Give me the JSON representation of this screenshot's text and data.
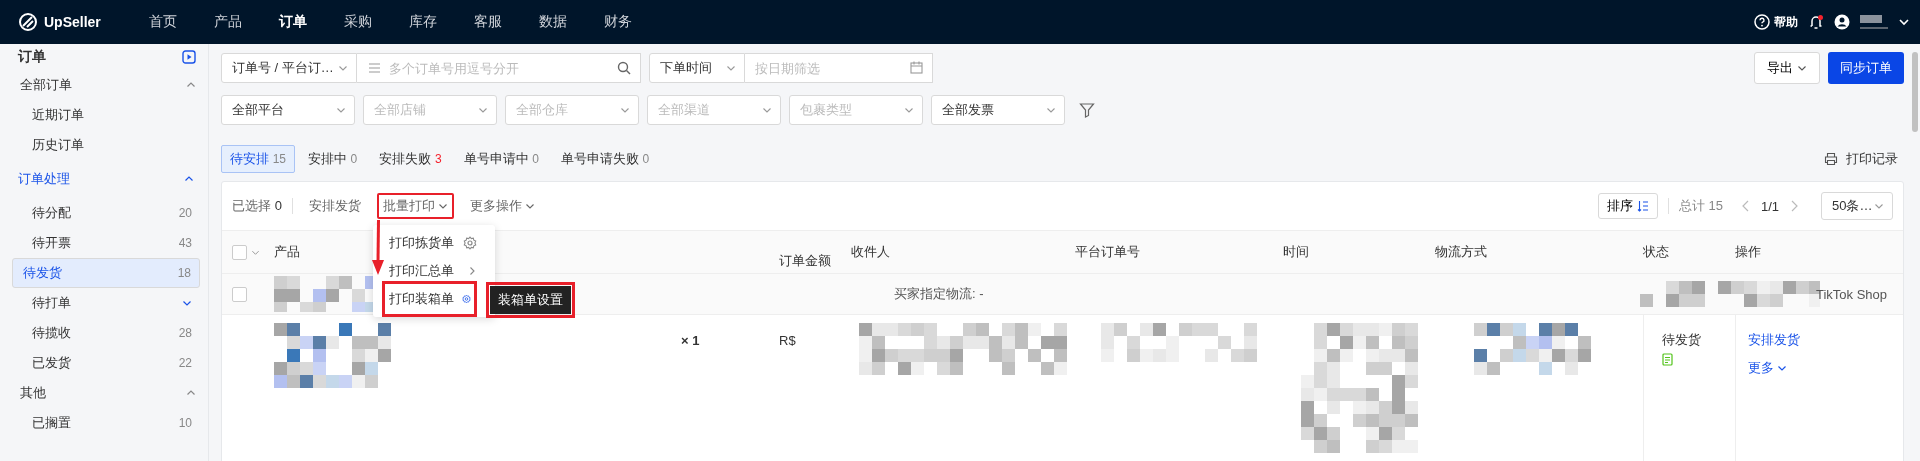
{
  "brand": "UpSeller",
  "nav": [
    {
      "label": "首页",
      "selected": false
    },
    {
      "label": "产品",
      "selected": false
    },
    {
      "label": "订单",
      "selected": true
    },
    {
      "label": "采购",
      "selected": false
    },
    {
      "label": "库存",
      "selected": false
    },
    {
      "label": "客服",
      "selected": false
    },
    {
      "label": "数据",
      "selected": false
    },
    {
      "label": "财务",
      "selected": false
    }
  ],
  "header": {
    "help": "帮助",
    "unread": true
  },
  "sidebar": {
    "title": "订单",
    "groups": [
      {
        "label": "全部订单",
        "active": false,
        "expanded": true,
        "items": [
          {
            "label": "近期订单",
            "kind": "link",
            "selected": false
          },
          {
            "label": "历史订单",
            "kind": "link",
            "selected": false
          }
        ]
      },
      {
        "label": "订单处理",
        "active": true,
        "expanded": true,
        "items": [
          {
            "label": "待分配",
            "kind": "count",
            "count": "20",
            "selected": false
          },
          {
            "label": "待开票",
            "kind": "count",
            "count": "43",
            "selected": false
          },
          {
            "label": "待发货",
            "kind": "count",
            "count": "18",
            "selected": true
          },
          {
            "label": "待打单",
            "kind": "submenu",
            "expanded": false,
            "selected": false
          },
          {
            "label": "待揽收",
            "kind": "count",
            "count": "28",
            "selected": false
          },
          {
            "label": "已发货",
            "kind": "count",
            "count": "22",
            "selected": false
          }
        ]
      },
      {
        "label": "其他",
        "active": false,
        "expanded": true,
        "items": [
          {
            "label": "已搁置",
            "kind": "count",
            "count": "10",
            "selected": false
          }
        ]
      }
    ]
  },
  "search": {
    "type": "订单号 / 平台订…",
    "placeholder": "多个订单号用逗号分开"
  },
  "date": {
    "type": "下单时间",
    "placeholder": "按日期筛选"
  },
  "selects": [
    {
      "value": "全部平台"
    },
    {
      "placeholder": "全部店铺"
    },
    {
      "placeholder": "全部仓库"
    },
    {
      "placeholder": "全部渠道"
    },
    {
      "placeholder": "包裹类型"
    },
    {
      "value": "全部发票"
    }
  ],
  "export": "导出",
  "sync": "同步订单",
  "status_tabs": [
    {
      "label": "待安排",
      "count": "15",
      "selected": true,
      "alert": false
    },
    {
      "label": "安排中",
      "count": "0",
      "selected": false,
      "alert": false
    },
    {
      "label": "安排失败",
      "count": "3",
      "selected": false,
      "alert": true
    },
    {
      "label": "单号申请中",
      "count": "0",
      "selected": false,
      "alert": false
    },
    {
      "label": "单号申请失败",
      "count": "0",
      "selected": false,
      "alert": false
    }
  ],
  "print_log": "打印记录",
  "toolbar": {
    "selected_label": "已选择",
    "selected_count": "0",
    "actions": [
      {
        "label": "安排发货",
        "kind": "plain",
        "highlighted": false
      },
      {
        "label": "批量打印",
        "kind": "menu",
        "highlighted": true
      },
      {
        "label": "更多操作",
        "kind": "menu",
        "highlighted": false
      }
    ],
    "sort": "排序",
    "total": "总计 15",
    "page": "1/1",
    "page_size": "50条…"
  },
  "print_menu": {
    "items": [
      {
        "label": "打印拣货单",
        "kind": "settings",
        "highlighted": false
      },
      {
        "label": "打印汇总单",
        "kind": "submenu",
        "highlighted": false
      },
      {
        "label": "打印装箱单",
        "kind": "settings",
        "highlighted": true
      }
    ],
    "tooltip": "装箱单设置"
  },
  "table": {
    "select_all": {
      "checked": false
    },
    "columns": [
      "产品",
      "订单金额",
      "收件人",
      "平台订单号",
      "时间",
      "物流方式",
      "状态",
      "操作"
    ],
    "group_row": {
      "checked": false,
      "logistics": "买家指定物流: -",
      "platform": "TikTok Shop"
    },
    "rows": [
      {
        "quantity": "× 1",
        "amount": "R$",
        "status": "待发货",
        "actions": [
          "安排发货"
        ],
        "more": "更多"
      }
    ]
  }
}
